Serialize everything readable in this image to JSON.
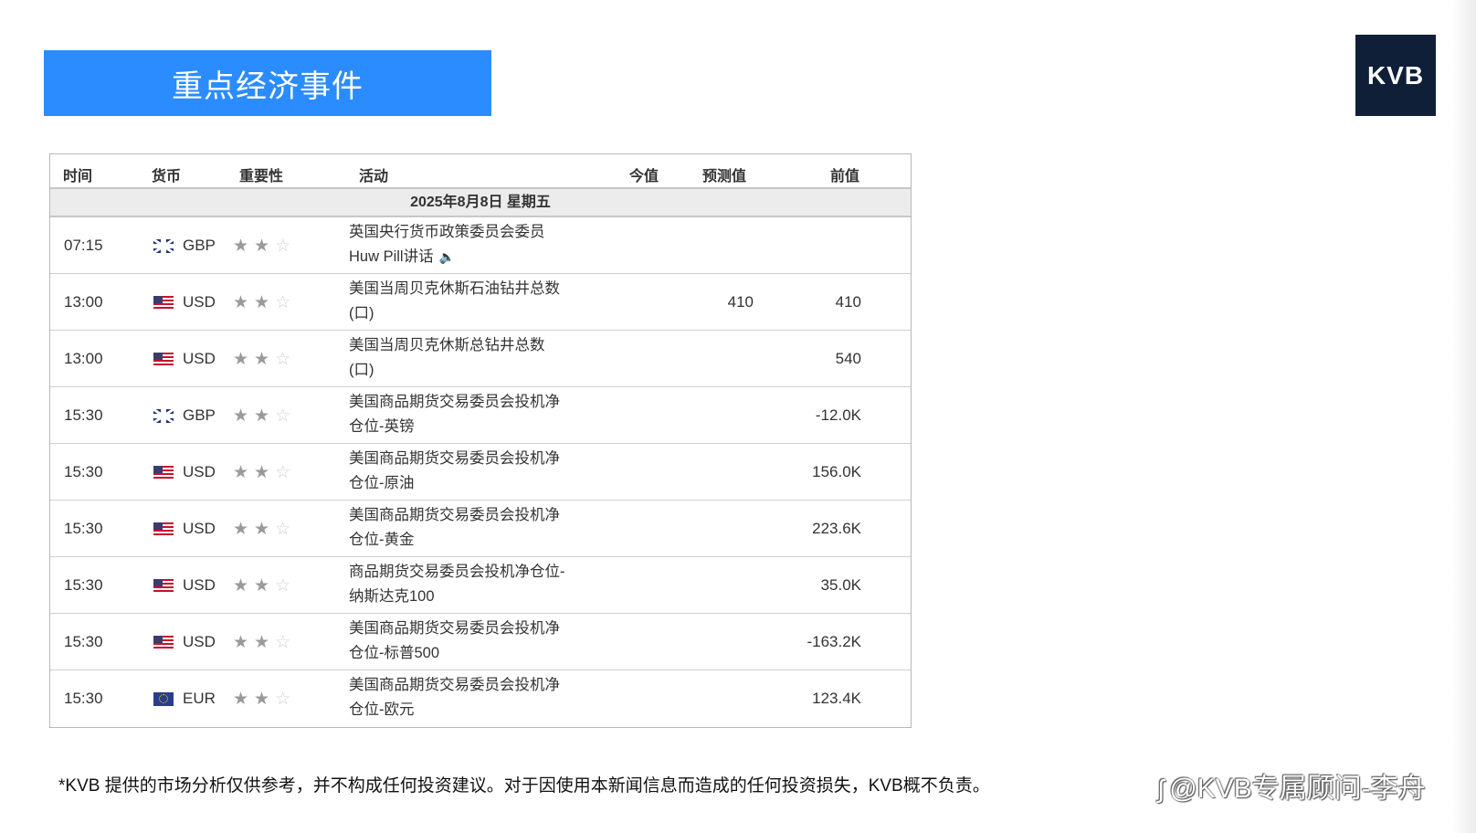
{
  "banner": {
    "title": "重点经济事件"
  },
  "logo": {
    "text": "KVB"
  },
  "table": {
    "headers": {
      "time": "时间",
      "currency": "货币",
      "importance": "重要性",
      "event": "活动",
      "actual": "今值",
      "forecast": "预测值",
      "previous": "前值"
    },
    "date": "2025年8月8日  星期五",
    "rows": [
      {
        "time": "07:15",
        "flag": "gb",
        "currency": "GBP",
        "stars": 2,
        "event_line1": "英国央行货币政策委员会委员",
        "event_line2": "Huw Pill讲话",
        "speaker": true,
        "actual": "",
        "forecast": "",
        "previous": ""
      },
      {
        "time": "13:00",
        "flag": "us",
        "currency": "USD",
        "stars": 2,
        "event_line1": "美国当周贝克休斯石油钻井总数",
        "event_line2": "(口)",
        "speaker": false,
        "actual": "",
        "forecast": "410",
        "previous": "410"
      },
      {
        "time": "13:00",
        "flag": "us",
        "currency": "USD",
        "stars": 2,
        "event_line1": "美国当周贝克休斯总钻井总数",
        "event_line2": "(口)",
        "speaker": false,
        "actual": "",
        "forecast": "",
        "previous": "540"
      },
      {
        "time": "15:30",
        "flag": "gb",
        "currency": "GBP",
        "stars": 2,
        "event_line1": "美国商品期货交易委员会投机净",
        "event_line2": "仓位-英镑",
        "speaker": false,
        "actual": "",
        "forecast": "",
        "previous": "-12.0K"
      },
      {
        "time": "15:30",
        "flag": "us",
        "currency": "USD",
        "stars": 2,
        "event_line1": "美国商品期货交易委员会投机净",
        "event_line2": "仓位-原油",
        "speaker": false,
        "actual": "",
        "forecast": "",
        "previous": "156.0K"
      },
      {
        "time": "15:30",
        "flag": "us",
        "currency": "USD",
        "stars": 2,
        "event_line1": "美国商品期货交易委员会投机净",
        "event_line2": "仓位-黄金",
        "speaker": false,
        "actual": "",
        "forecast": "",
        "previous": "223.6K"
      },
      {
        "time": "15:30",
        "flag": "us",
        "currency": "USD",
        "stars": 2,
        "event_line1": "商品期货交易委员会投机净仓位-",
        "event_line2": "纳斯达克100",
        "speaker": false,
        "actual": "",
        "forecast": "",
        "previous": "35.0K"
      },
      {
        "time": "15:30",
        "flag": "us",
        "currency": "USD",
        "stars": 2,
        "event_line1": "美国商品期货交易委员会投机净",
        "event_line2": "仓位-标普500",
        "speaker": false,
        "actual": "",
        "forecast": "",
        "previous": "-163.2K"
      },
      {
        "time": "15:30",
        "flag": "eu",
        "currency": "EUR",
        "stars": 2,
        "event_line1": "美国商品期货交易委员会投机净",
        "event_line2": "仓位-欧元",
        "speaker": false,
        "actual": "",
        "forecast": "",
        "previous": "123.4K"
      }
    ]
  },
  "disclaimer": "*KVB 提供的市场分析仅供参考，并不构成任何投资建议。对于因使用本新闻信息而造成的任何投资损失，KVB概不负责。",
  "watermark": "@KVB专属顾问-李舟",
  "colors": {
    "banner": "#2b8cff",
    "logo_bg": "#0f1f38",
    "date_row_bg": "#ececec"
  }
}
